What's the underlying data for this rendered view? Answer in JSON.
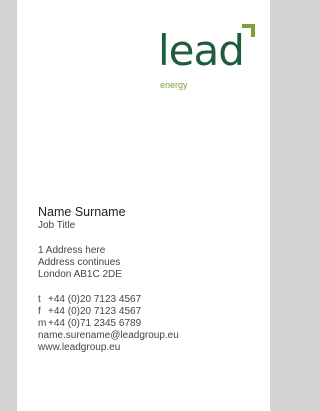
{
  "logo": {
    "word": "lead",
    "sub": "energy"
  },
  "contact": {
    "name": "Name Surname",
    "job_title": "Job Title",
    "address": [
      "1 Address here",
      "Address continues",
      "London AB1C 2DE"
    ],
    "phones": [
      {
        "prefix": "t",
        "number": "+44 (0)20 7123 4567"
      },
      {
        "prefix": "f",
        "number": "+44 (0)20 7123 4567"
      },
      {
        "prefix": "m",
        "number": "+44 (0)71 2345 6789"
      }
    ],
    "email": "name.surename@leadgroup.eu",
    "website": "www.leadgroup.eu"
  },
  "colors": {
    "background": "#d4d4d4",
    "card": "#ffffff",
    "brand_dark_green": "#1f5c3b",
    "brand_light_green": "#7aa33b",
    "text": "#444444"
  }
}
